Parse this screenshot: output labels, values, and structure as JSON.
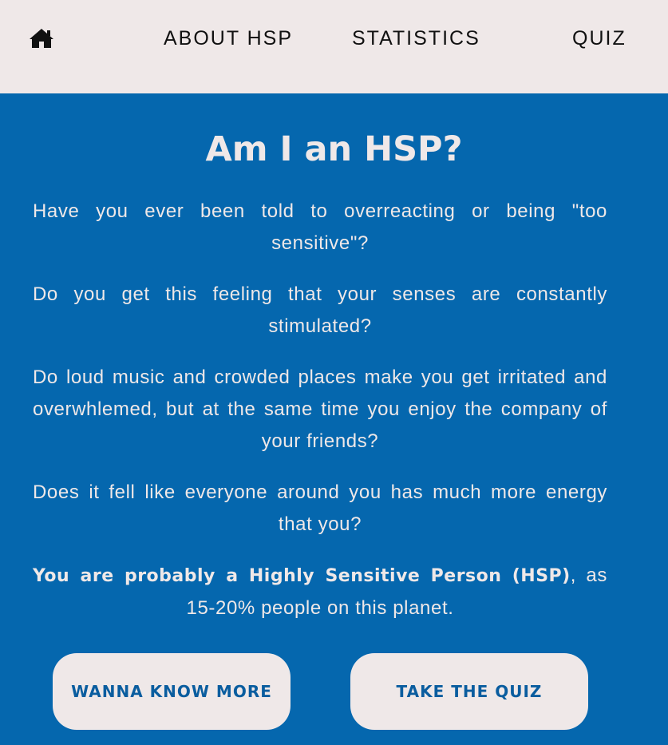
{
  "nav": {
    "home_icon": "home-icon",
    "items": [
      {
        "label": "ABOUT HSP"
      },
      {
        "label": "STATISTICS"
      },
      {
        "label": "QUIZ"
      }
    ]
  },
  "hero": {
    "title": "Am I an HSP?",
    "paragraphs": [
      "Have you ever been told to overreacting or being \"too sensitive\"?",
      "Do you get this feeling that your senses are constantly stimulated?",
      "Do loud music and crowded places make you get irritated and overwhlemed, but at the same time you enjoy the company of your friends?",
      "Does it fell like everyone around you has much more energy that you?"
    ],
    "final_bold": "You are probably a Highly Sensitive Person (HSP)",
    "final_rest": ", as 15-20% people on this planet."
  },
  "buttons": {
    "more_label": "WANNA KNOW MORE",
    "quiz_label": "TAKE THE QUIZ"
  },
  "colors": {
    "primary_blue": "#0567ae",
    "cream": "#efe8e8",
    "button_text": "#0a5d9f"
  }
}
